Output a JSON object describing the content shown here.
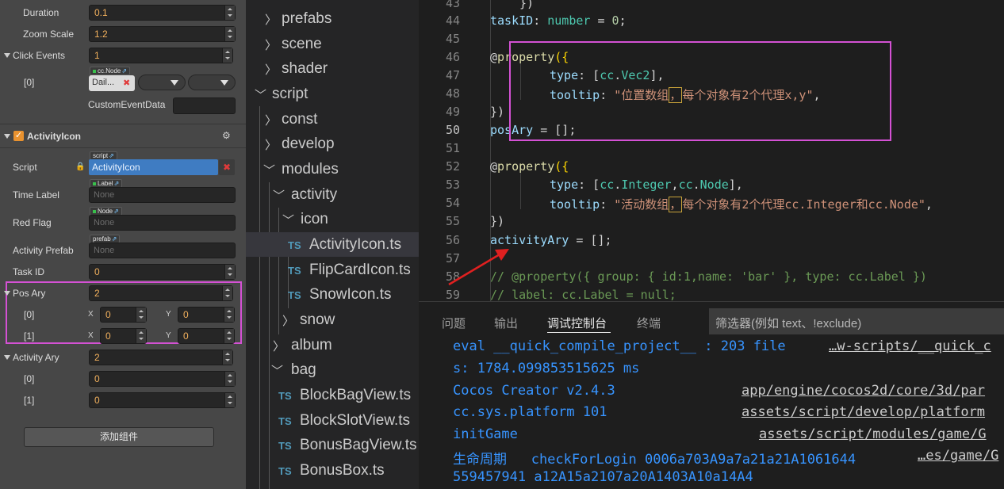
{
  "inspector": {
    "duration": {
      "label": "Duration",
      "value": "0.1"
    },
    "zoom_scale": {
      "label": "Zoom Scale",
      "value": "1.2"
    },
    "click_events": {
      "label": "Click Events",
      "value": "1"
    },
    "click_event_0": {
      "label": "[0]",
      "node_tag": "cc.Node",
      "node_value": "Dail...",
      "remove_glyph": "✖"
    },
    "custom_event_data": {
      "label": "CustomEventData",
      "value": ""
    },
    "component": {
      "title": "ActivityIcon",
      "check": "✓",
      "gear": "⚙"
    },
    "script": {
      "label": "Script",
      "tag": "script",
      "value": "ActivityIcon",
      "lock": "🔒",
      "remove_glyph": "✖"
    },
    "time_label": {
      "label": "Time Label",
      "tag": "Label",
      "placeholder": "None"
    },
    "red_flag": {
      "label": "Red Flag",
      "tag": "Node",
      "placeholder": "None"
    },
    "activity_prefab": {
      "label": "Activity Prefab",
      "tag": "prefab",
      "placeholder": "None"
    },
    "task_id": {
      "label": "Task ID",
      "value": "0"
    },
    "pos_ary": {
      "label": "Pos Ary",
      "value": "2",
      "items": [
        {
          "label": "[0]",
          "x_label": "X",
          "x": "0",
          "y_label": "Y",
          "y": "0"
        },
        {
          "label": "[1]",
          "x_label": "X",
          "x": "0",
          "y_label": "Y",
          "y": "0"
        }
      ]
    },
    "activity_ary": {
      "label": "Activity Ary",
      "value": "2",
      "items": [
        {
          "label": "[0]",
          "value": "0"
        },
        {
          "label": "[1]",
          "value": "0"
        }
      ]
    },
    "add_component": "添加组件"
  },
  "explorer": {
    "items": [
      {
        "name": "prefabs",
        "kind": "folder",
        "open": false
      },
      {
        "name": "scene",
        "kind": "folder",
        "open": false
      },
      {
        "name": "shader",
        "kind": "folder",
        "open": false
      },
      {
        "name": "script",
        "kind": "folder",
        "open": true
      },
      {
        "name": "const",
        "kind": "folder",
        "open": false
      },
      {
        "name": "develop",
        "kind": "folder",
        "open": false
      },
      {
        "name": "modules",
        "kind": "folder",
        "open": true
      },
      {
        "name": "activity",
        "kind": "folder",
        "open": true
      },
      {
        "name": "icon",
        "kind": "folder",
        "open": true
      },
      {
        "name": "ActivityIcon.ts",
        "kind": "file",
        "selected": true
      },
      {
        "name": "FlipCardIcon.ts",
        "kind": "file"
      },
      {
        "name": "SnowIcon.ts",
        "kind": "file"
      },
      {
        "name": "snow",
        "kind": "folder",
        "open": false
      },
      {
        "name": "album",
        "kind": "folder",
        "open": false
      },
      {
        "name": "bag",
        "kind": "folder",
        "open": true
      },
      {
        "name": "BlockBagView.ts",
        "kind": "file"
      },
      {
        "name": "BlockSlotView.ts",
        "kind": "file"
      },
      {
        "name": "BonusBagView.ts",
        "kind": "file"
      },
      {
        "name": "BonusBox.ts",
        "kind": "file"
      }
    ],
    "ts_badge": "TS"
  },
  "editor": {
    "line_numbers": [
      "44",
      "45",
      "46",
      "47",
      "48",
      "49",
      "50",
      "51",
      "52",
      "53",
      "54",
      "55",
      "56",
      "57",
      "58",
      "59"
    ],
    "lines": {
      "l43": "})",
      "l44a": "taskID",
      "l44b": ": ",
      "l44c": "number",
      "l44d": " = ",
      "l44e": "0",
      "l44f": ";",
      "l46a": "@",
      "l46b": "property",
      "l46c": "({",
      "l47a": "type",
      "l47b": ": [",
      "l47c": "cc",
      "l47d": ".",
      "l47e": "Vec2",
      "l47f": "],",
      "l48a": "tooltip",
      "l48b": ": ",
      "l48c": "\"位置数组",
      "l48d": "，",
      "l48e": "每个对象有2个代理x,y\"",
      "l48f": ",",
      "l49": "})",
      "l50a": "posAry",
      "l50b": " = [];",
      "l52a": "@",
      "l52b": "property",
      "l52c": "({",
      "l53a": "type",
      "l53b": ": [",
      "l53c": "cc",
      "l53d": ".",
      "l53e": "Integer",
      "l53f": ",",
      "l53g": "cc",
      "l53h": ".",
      "l53i": "Node",
      "l53j": "],",
      "l54a": "tooltip",
      "l54b": ": ",
      "l54c": "\"活动数组",
      "l54d": "，",
      "l54e": "每个对象有2个代理cc.Integer和cc.Node\"",
      "l54f": ",",
      "l55": "})",
      "l56a": "activityAry",
      "l56b": " = [];",
      "l58": "// @property({ group: { id:1,name: 'bar' }, type: cc.Label })",
      "l59": "// label: cc.Label = null;"
    },
    "highlight_color": "#d451d4",
    "arrow_color": "#e02020"
  },
  "panel": {
    "tabs": [
      "问题",
      "输出",
      "调试控制台",
      "终端"
    ],
    "active_tab": "调试控制台",
    "filter_placeholder": "筛选器(例如 text、!exclude)",
    "output": [
      {
        "text": "eval __quick_compile_project__ : 203 file",
        "src": "…w-scripts/__quick_c"
      },
      {
        "text": "s: 1784.099853515625 ms",
        "src": ""
      },
      {
        "text": "Cocos Creator v2.4.3",
        "src": "app/engine/cocos2d/core/3d/par"
      },
      {
        "text": "cc.sys.platform 101",
        "src": "assets/script/develop/platform"
      },
      {
        "text": "initGame",
        "src": "assets/script/modules/game/G"
      },
      {
        "text": "生命周期   checkForLogin 0006a703A9a7a21a21A1061644",
        "src": "…es/game/G"
      },
      {
        "text": "559457941 a12A15a2107a20A1403A10a14A4",
        "src": ""
      }
    ]
  }
}
